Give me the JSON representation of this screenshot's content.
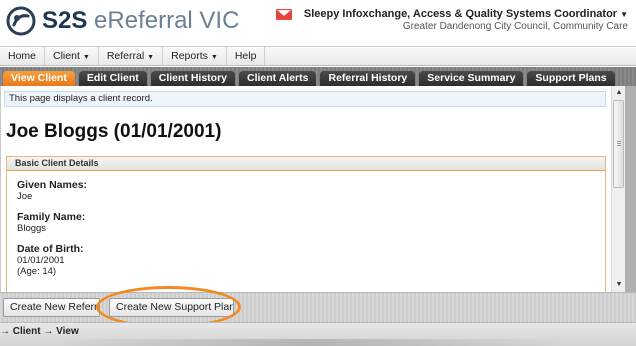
{
  "app": {
    "logo_bold": "S2S",
    "logo_light": "eReferral VIC"
  },
  "user": {
    "name": "Sleepy Infoxchange, Access & Quality Systems Coordinator",
    "organisation": "Greater Dandenong City Council, Community Care"
  },
  "menu": {
    "items": [
      {
        "label": "Home",
        "has_dropdown": false
      },
      {
        "label": "Client",
        "has_dropdown": true
      },
      {
        "label": "Referral",
        "has_dropdown": true
      },
      {
        "label": "Reports",
        "has_dropdown": true
      },
      {
        "label": "Help",
        "has_dropdown": false
      }
    ]
  },
  "tabs": [
    {
      "label": "View Client",
      "active": true
    },
    {
      "label": "Edit Client",
      "active": false
    },
    {
      "label": "Client History",
      "active": false
    },
    {
      "label": "Client Alerts",
      "active": false
    },
    {
      "label": "Referral History",
      "active": false
    },
    {
      "label": "Service Summary",
      "active": false
    },
    {
      "label": "Support Plans",
      "active": false
    }
  ],
  "page": {
    "info": "This page displays a client record.",
    "title": "Joe Bloggs (01/01/2001)"
  },
  "section": {
    "title": "Basic Client Details",
    "given_names_label": "Given Names:",
    "given_names_value": "Joe",
    "family_name_label": "Family Name:",
    "family_name_value": "Bloggs",
    "dob_label": "Date of Birth:",
    "dob_value": "01/01/2001",
    "age_value": "(Age: 14)"
  },
  "buttons": {
    "create_referral": "Create New Referral",
    "create_support_plan": "Create New Support Plan"
  },
  "footer": {
    "breadcrumb": "→ Client → View"
  },
  "colors": {
    "accent_orange": "#f08a24",
    "active_tab": "#e9781c",
    "tab_dark": "#2e2e2e",
    "mail_red": "#e4463f"
  },
  "icons": {
    "logo": "s2s-logo-icon",
    "mail": "envelope-icon",
    "dropdown": "chevron-down-icon"
  }
}
